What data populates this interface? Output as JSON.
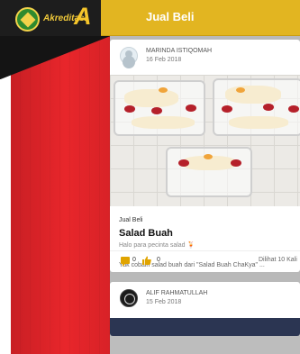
{
  "header": {
    "logo_text": "Akreditasi",
    "logo_letter": "A",
    "title": "Jual Beli"
  },
  "colors": {
    "header": "#e2b521",
    "sidebar_red": "#e8262b",
    "logo_dark": "#1d1d1d",
    "accent_icon": "#e0a400"
  },
  "posts": [
    {
      "author": "MARINDA ISTIQOMAH",
      "date": "16 Feb 2018",
      "category": "Jual Beli",
      "title": "Salad Buah",
      "subtitle": "Halo para pecinta salad 🍹",
      "excerpt": "Yuk cobain salad buah dari \"Salad Buah ChaKya\" ...",
      "comments": "0",
      "likes": "0",
      "views": "Dilihat 10 Kali",
      "icons": [
        "comment-icon",
        "like-icon"
      ]
    },
    {
      "author": "ALIF RAHMATULLAH",
      "date": "15 Feb 2018"
    }
  ]
}
